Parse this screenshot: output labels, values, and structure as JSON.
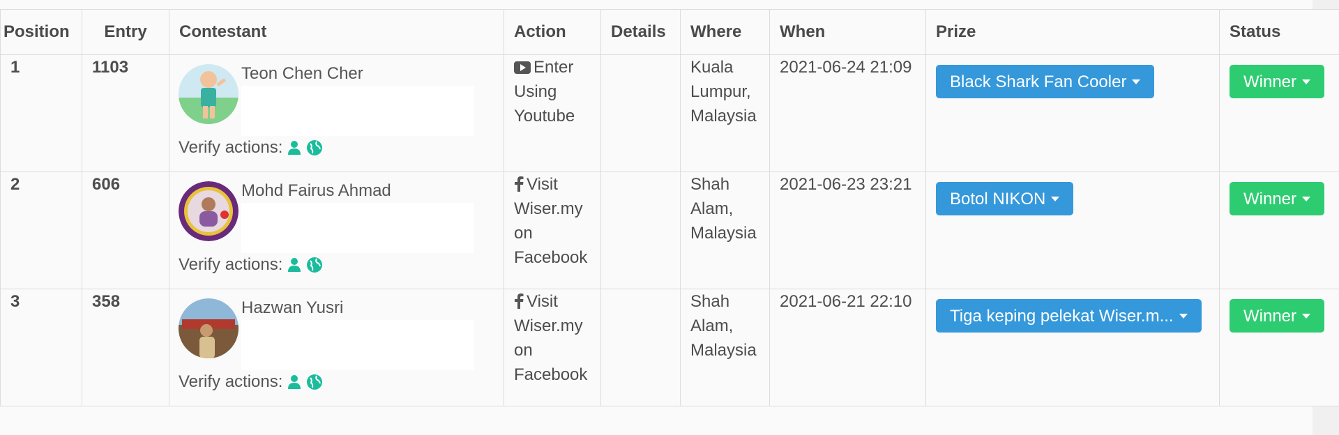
{
  "colors": {
    "prize_button": "#3498db",
    "status_button": "#2ecc71",
    "icon_green": "#1abc9c"
  },
  "table": {
    "headers": {
      "position": "Position",
      "entry": "Entry",
      "contestant": "Contestant",
      "action": "Action",
      "details": "Details",
      "where": "Where",
      "when": "When",
      "prize": "Prize",
      "status": "Status"
    },
    "verify_label": "Verify actions:",
    "rows": [
      {
        "position": "1",
        "entry": "1103",
        "name": "Teon Chen Cher",
        "action_icon": "youtube-icon",
        "action": "Enter Using Youtube",
        "details": "",
        "where": "Kuala Lumpur, Malaysia",
        "when": "2021-06-24 21:09",
        "prize": "Black Shark Fan Cooler",
        "status": "Winner"
      },
      {
        "position": "2",
        "entry": "606",
        "name": "Mohd Fairus Ahmad",
        "action_icon": "facebook-icon",
        "action": "Visit Wiser.my on Facebook",
        "details": "",
        "where": "Shah Alam, Malaysia",
        "when": "2021-06-23 23:21",
        "prize": "Botol NIKON",
        "status": "Winner"
      },
      {
        "position": "3",
        "entry": "358",
        "name": "Hazwan Yusri",
        "action_icon": "facebook-icon",
        "action": "Visit Wiser.my on Facebook",
        "details": "",
        "where": "Shah Alam, Malaysia",
        "when": "2021-06-21 22:10",
        "prize": "Tiga keping pelekat Wiser.m...",
        "status": "Winner"
      }
    ]
  }
}
